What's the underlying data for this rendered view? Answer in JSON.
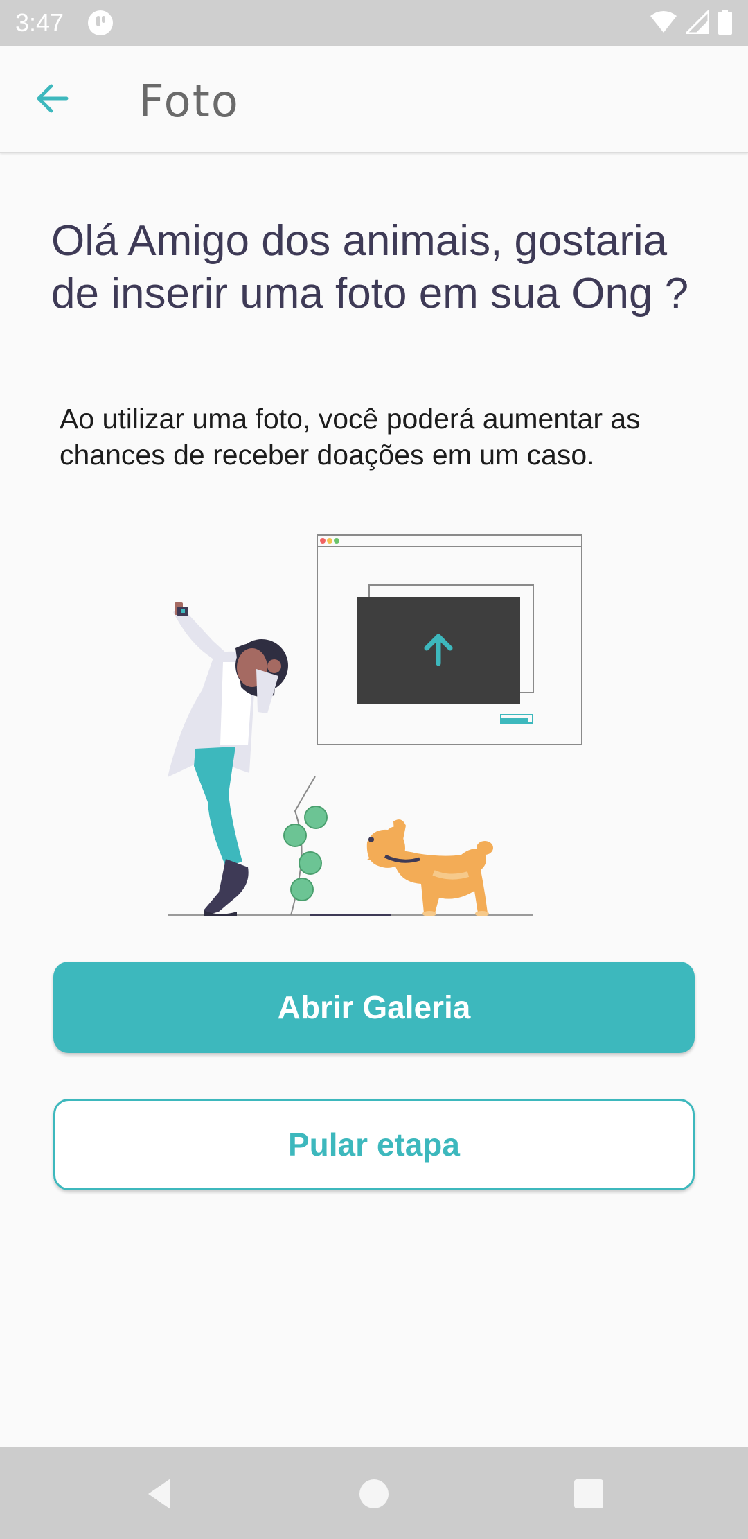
{
  "status_bar": {
    "time": "3:47"
  },
  "app_bar": {
    "title": "Foto"
  },
  "content": {
    "heading": "Olá Amigo dos animais, gostaria de inserir uma foto em sua Ong ?",
    "subtext": "Ao utilizar uma foto, você poderá aumentar as chances de receber doações em um caso."
  },
  "buttons": {
    "open_gallery": "Abrir Galeria",
    "skip_step": "Pular etapa"
  },
  "colors": {
    "accent": "#3db8bd",
    "heading_text": "#3e3a56",
    "dog": "#f3ac56"
  },
  "icons": {
    "back": "arrow-left-icon",
    "upload": "arrow-up-icon",
    "nav_back": "triangle-back-icon",
    "nav_home": "circle-home-icon",
    "nav_recents": "square-recents-icon"
  }
}
